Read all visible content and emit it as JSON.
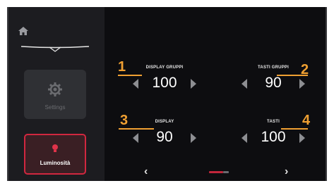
{
  "sidebar": {
    "settings_label": "Settings",
    "luminosita_label": "Luminosità"
  },
  "controls": [
    {
      "label": "DISPLAY GRUPPI",
      "value": "100",
      "callout": "1"
    },
    {
      "label": "TASTI GRUPPI",
      "value": "90",
      "callout": "2"
    },
    {
      "label": "DISPLAY",
      "value": "90",
      "callout": "3"
    },
    {
      "label": "TASTI",
      "value": "100",
      "callout": "4"
    }
  ],
  "nav": {
    "prev": "‹",
    "next": "›"
  },
  "colors": {
    "accent_red": "#d1273f",
    "callout_orange": "#f0a032",
    "background": "#0d0d10",
    "sidebar": "#1c1c20"
  }
}
